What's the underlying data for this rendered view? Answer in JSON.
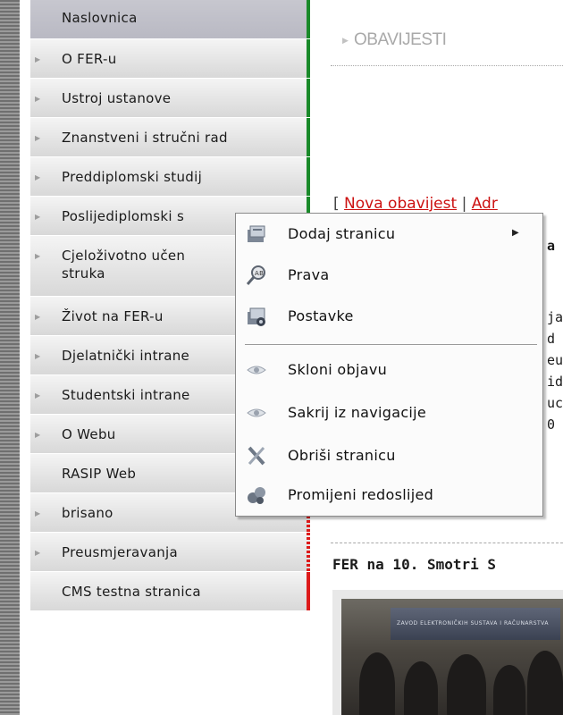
{
  "sidebar": {
    "items": [
      {
        "label": "Naslovnica",
        "arrow": false,
        "bar": "green"
      },
      {
        "label": "O FER-u",
        "arrow": true,
        "bar": "green"
      },
      {
        "label": "Ustroj ustanove",
        "arrow": true,
        "bar": "green"
      },
      {
        "label": "Znanstveni i stručni rad",
        "arrow": true,
        "bar": "green"
      },
      {
        "label": "Preddiplomski studij",
        "arrow": true,
        "bar": "green"
      },
      {
        "label": "Poslijediplomski s",
        "arrow": true,
        "bar": "green"
      },
      {
        "label": "Cjeloživotno učen struka",
        "arrow": true,
        "bar": "green"
      },
      {
        "label": "Život na FER-u",
        "arrow": true,
        "bar": "green"
      },
      {
        "label": "Djelatnički intrane",
        "arrow": true,
        "bar": "green"
      },
      {
        "label": "Studentski intrane",
        "arrow": true,
        "bar": "green"
      },
      {
        "label": "O Webu",
        "arrow": true,
        "bar": "green"
      },
      {
        "label": "RASIP Web",
        "arrow": false,
        "bar": "red"
      },
      {
        "label": "brisano",
        "arrow": true,
        "bar": "red-dotted"
      },
      {
        "label": "Preusmjeravanja",
        "arrow": true,
        "bar": "red-dotted"
      },
      {
        "label": "CMS testna stranica",
        "arrow": false,
        "bar": "red"
      }
    ]
  },
  "main": {
    "title": "OBAVIJESTI",
    "actions": {
      "open": "[",
      "new_notice": "Nova obavijest",
      "sep": "|",
      "admin_partial": "Adr"
    },
    "behind_menu_text": [
      "a",
      "ja",
      "d",
      "eu",
      "id",
      "uc",
      "0"
    ],
    "news_headline": "FER na 10. Smotri S",
    "photo_booth_text": "ZAVOD ELEKTRONIČKIH SUSTAVA I RAČUNARSTVA"
  },
  "context_menu": {
    "items": [
      {
        "label": "Dodaj stranicu",
        "icon": "add-page-icon",
        "submenu": "▶"
      },
      {
        "label": "Prava",
        "icon": "permissions-icon"
      },
      {
        "label": "Postavke",
        "icon": "settings-icon"
      },
      {
        "label": "Skloni objavu",
        "icon": "eye-icon"
      },
      {
        "label": "Sakrij iz navigacije",
        "icon": "eye-icon"
      },
      {
        "label": "Obriši stranicu",
        "icon": "delete-icon"
      },
      {
        "label": "Promijeni redoslijed",
        "icon": "reorder-icon"
      }
    ]
  },
  "colors": {
    "accent_green": "#1a8a2a",
    "accent_red": "#dd1b1b",
    "link_red": "#cc1111"
  }
}
